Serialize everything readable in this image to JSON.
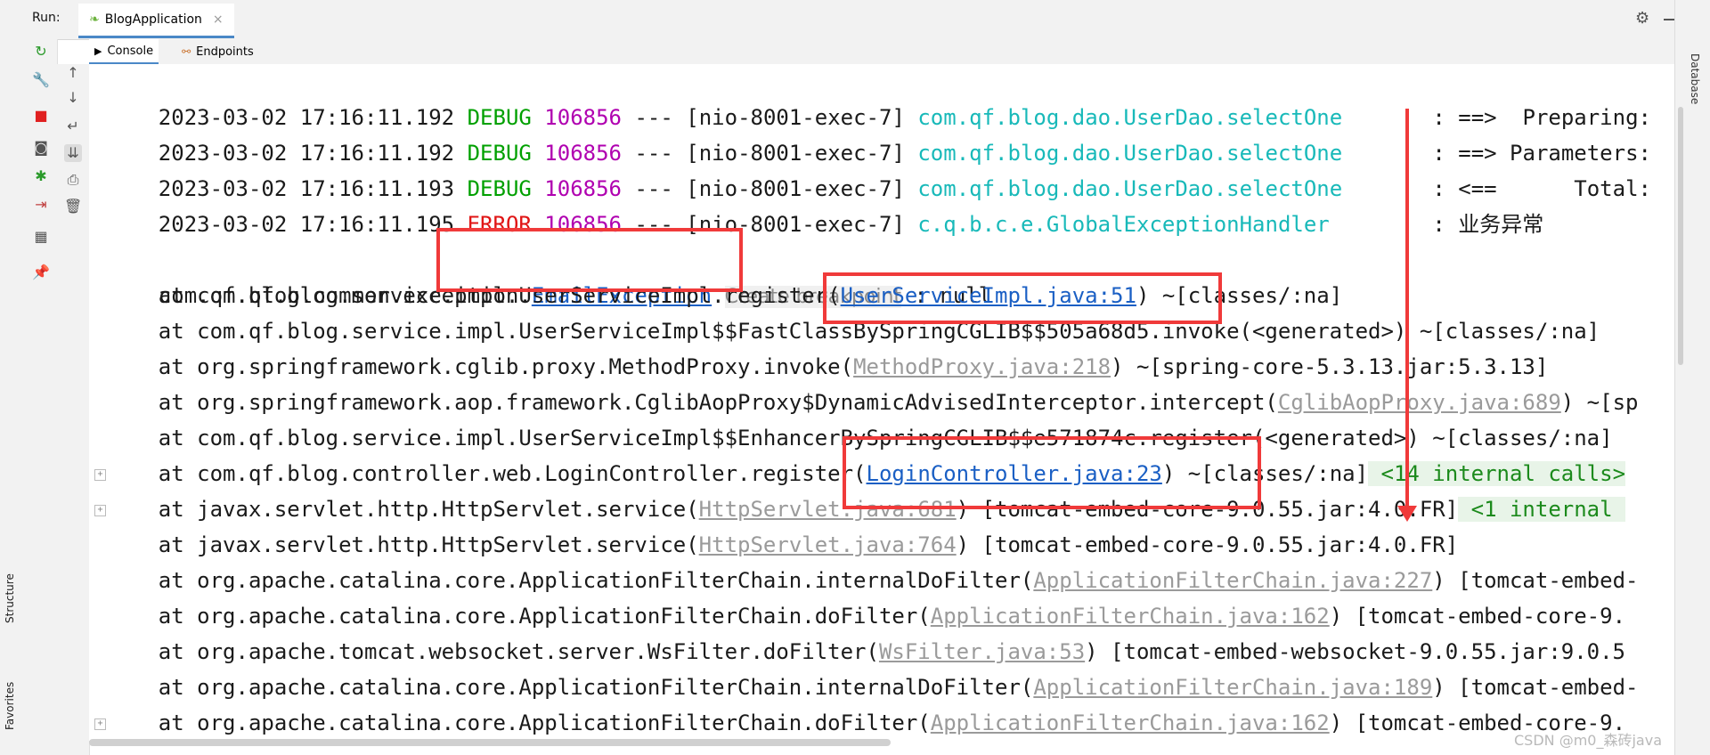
{
  "run_header": {
    "run_label": "Run:",
    "tab_title": "BlogApplication",
    "close_glyph": "×",
    "settings_icon": "gear-icon",
    "minimize_icon": "minimize-icon"
  },
  "subtabs": [
    {
      "label": "Console",
      "icon": "console-icon",
      "active": true
    },
    {
      "label": "Endpoints",
      "icon": "endpoints-icon",
      "active": false
    }
  ],
  "left_stripe": {
    "structure": "Structure",
    "favorites": "Favorites"
  },
  "right_stripe": {
    "database": "Database"
  },
  "log_lines": [
    {
      "timestamp": "2023-03-02 17:16:11.192",
      "level": "DEBUG",
      "pid": "106856",
      "sep": "---",
      "thread": "[nio-8001-exec-7]",
      "logger": "com.qf.blog.dao.UserDao.selectOne",
      "message": ": ==>  Preparing:"
    },
    {
      "timestamp": "2023-03-02 17:16:11.192",
      "level": "DEBUG",
      "pid": "106856",
      "sep": "---",
      "thread": "[nio-8001-exec-7]",
      "logger": "com.qf.blog.dao.UserDao.selectOne",
      "message": ": ==> Parameters:"
    },
    {
      "timestamp": "2023-03-02 17:16:11.193",
      "level": "DEBUG",
      "pid": "106856",
      "sep": "---",
      "thread": "[nio-8001-exec-7]",
      "logger": "com.qf.blog.dao.UserDao.selectOne",
      "message": ": <==      Total:"
    },
    {
      "timestamp": "2023-03-02 17:16:11.195",
      "level": "ERROR",
      "pid": "106856",
      "sep": "---",
      "thread": "[nio-8001-exec-7]",
      "logger": "c.q.b.c.e.GlobalExceptionHandler",
      "message": ": 业务异常"
    }
  ],
  "exception": {
    "prefix": "com.qf.blog.common.exception.",
    "class_link": "EmailException",
    "hint": "Create breakpoint",
    "suffix": ": null"
  },
  "stack": [
    {
      "pre": "    at com.qf.blog.service.impl.UserServiceImpl.register(",
      "link": "UserServiceImpl.java:51",
      "link_style": "link",
      "post": ") ~[classes/:na]",
      "extra": ""
    },
    {
      "pre": "    at com.qf.blog.service.impl.UserServiceImpl$$FastClassBySpringCGLIB$$505a68d5.invoke(<generated>) ~[classes/:na]",
      "link": "",
      "link_style": "",
      "post": "",
      "extra": ""
    },
    {
      "pre": "    at org.springframework.cglib.proxy.MethodProxy.invoke(",
      "link": "MethodProxy.java:218",
      "link_style": "faded",
      "post": ") ~[spring-core-5.3.13.jar:5.3.13]",
      "extra": ""
    },
    {
      "pre": "    at org.springframework.aop.framework.CglibAopProxy$DynamicAdvisedInterceptor.intercept(",
      "link": "CglibAopProxy.java:689",
      "link_style": "faded",
      "post": ") ~[sp",
      "extra": ""
    },
    {
      "pre": "    at com.qf.blog.service.impl.UserServiceImpl$$EnhancerBySpringCGLIB$$e571874c.register(<generated>) ~[classes/:na]",
      "link": "",
      "link_style": "",
      "post": "",
      "extra": ""
    },
    {
      "pre": "    at com.qf.blog.controller.web.LoginController.register(",
      "link": "LoginController.java:23",
      "link_style": "link",
      "post": ") ~[classes/:na]",
      "extra": " <14 internal calls>"
    },
    {
      "pre": "    at javax.servlet.http.HttpServlet.service(",
      "link": "HttpServlet.java:681",
      "link_style": "faded",
      "post": ") [tomcat-embed-core-9.0.55.jar:4.0.FR]",
      "extra": " <1 internal "
    },
    {
      "pre": "    at javax.servlet.http.HttpServlet.service(",
      "link": "HttpServlet.java:764",
      "link_style": "faded",
      "post": ") [tomcat-embed-core-9.0.55.jar:4.0.FR]",
      "extra": ""
    },
    {
      "pre": "    at org.apache.catalina.core.ApplicationFilterChain.internalDoFilter(",
      "link": "ApplicationFilterChain.java:227",
      "link_style": "faded",
      "post": ") [tomcat-embed-",
      "extra": ""
    },
    {
      "pre": "    at org.apache.catalina.core.ApplicationFilterChain.doFilter(",
      "link": "ApplicationFilterChain.java:162",
      "link_style": "faded",
      "post": ") [tomcat-embed-core-9.",
      "extra": ""
    },
    {
      "pre": "    at org.apache.tomcat.websocket.server.WsFilter.doFilter(",
      "link": "WsFilter.java:53",
      "link_style": "faded",
      "post": ") [tomcat-embed-websocket-9.0.55.jar:9.0.5",
      "extra": ""
    },
    {
      "pre": "    at org.apache.catalina.core.ApplicationFilterChain.internalDoFilter(",
      "link": "ApplicationFilterChain.java:189",
      "link_style": "faded",
      "post": ") [tomcat-embed-",
      "extra": ""
    },
    {
      "pre": "    at org.apache.catalina.core.ApplicationFilterChain.doFilter(",
      "link": "ApplicationFilterChain.java:162",
      "link_style": "faded",
      "post": ") [tomcat-embed-core-9.",
      "extra": ""
    }
  ],
  "watermark": "CSDN @m0_森砖java",
  "colors": {
    "debug": "#00a000",
    "error": "#e01515",
    "pid": "#b000b0",
    "logger": "#18b9b9",
    "link": "#1a5fc4",
    "annotation_red": "#f03a3a"
  }
}
